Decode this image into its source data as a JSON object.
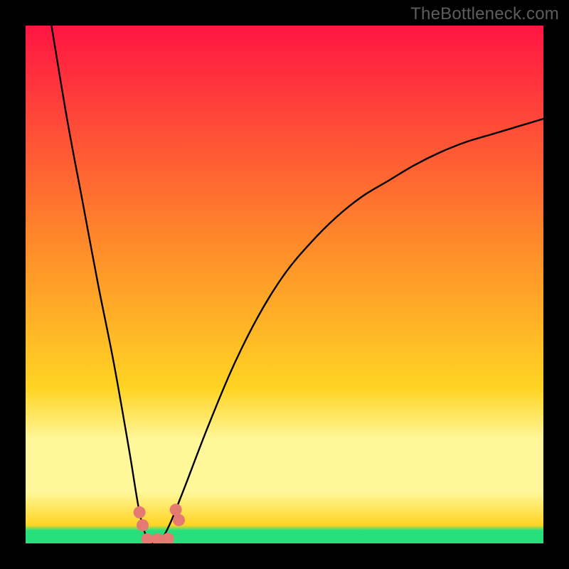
{
  "watermark": "TheBottleneck.com",
  "colors": {
    "top": "#ff1543",
    "mid1": "#ff8a2a",
    "mid2": "#ffd423",
    "band": "#fff79a",
    "green": "#27e07b",
    "frame": "#000000",
    "curve": "#000000",
    "marker": "#e57a73"
  },
  "chart_data": {
    "type": "line",
    "title": "",
    "xlabel": "",
    "ylabel": "",
    "xlim": [
      0,
      100
    ],
    "ylim": [
      0,
      100
    ],
    "series": [
      {
        "name": "bottleneck-curve",
        "x": [
          5,
          8,
          11,
          14,
          17,
          20,
          22,
          23.5,
          25,
          27,
          30,
          35,
          40,
          45,
          50,
          55,
          60,
          65,
          70,
          75,
          80,
          85,
          90,
          95,
          100
        ],
        "values": [
          100,
          82,
          66,
          50,
          35,
          18,
          6,
          1,
          0,
          2,
          9,
          22,
          34,
          44,
          52,
          58,
          63,
          67,
          70,
          73,
          75.5,
          77.5,
          79,
          80.5,
          82
        ]
      }
    ],
    "markers": [
      {
        "x": 22.0,
        "y": 6.0
      },
      {
        "x": 22.6,
        "y": 3.5
      },
      {
        "x": 29.0,
        "y": 6.5
      },
      {
        "x": 29.6,
        "y": 4.5
      },
      {
        "x": 23.5,
        "y": 0.8
      },
      {
        "x": 25.5,
        "y": 0.8
      },
      {
        "x": 27.5,
        "y": 0.9
      }
    ],
    "bands": [
      {
        "from": 0,
        "to": 77,
        "role": "gradient-red-yellow"
      },
      {
        "from": 77,
        "to": 85,
        "role": "pale-yellow"
      },
      {
        "from": 96,
        "to": 100,
        "role": "green"
      }
    ]
  }
}
